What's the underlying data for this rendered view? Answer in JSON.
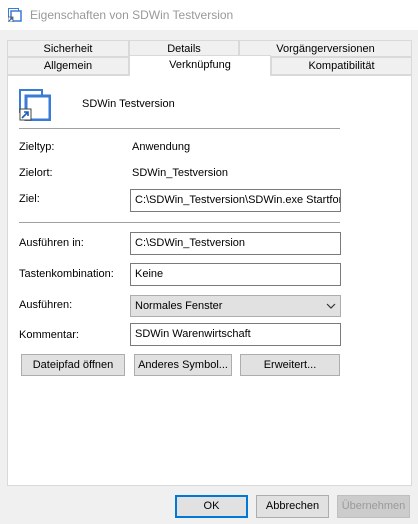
{
  "window": {
    "title": "Eigenschaften von SDWin Testversion"
  },
  "tabs": {
    "row1": [
      "Sicherheit",
      "Details",
      "Vorgängerversionen"
    ],
    "row2": [
      "Allgemein",
      "Verknüpfung",
      "Kompatibilität"
    ],
    "active": "Verknüpfung"
  },
  "header": {
    "name": "SDWin Testversion",
    "icon": "shortcut-icon"
  },
  "fields": {
    "zieltyp": {
      "label": "Zieltyp:",
      "value": "Anwendung"
    },
    "zielort": {
      "label": "Zielort:",
      "value": "SDWin_Testversion"
    },
    "ziel": {
      "label": "Ziel:",
      "value": "C:\\SDWin_Testversion\\SDWin.exe Startform"
    },
    "ausfuehren_in": {
      "label": "Ausführen in:",
      "value": "C:\\SDWin_Testversion"
    },
    "tastenkombination": {
      "label": "Tastenkombination:",
      "value": "Keine"
    },
    "ausfuehren": {
      "label": "Ausführen:",
      "value": "Normales Fenster"
    },
    "kommentar": {
      "label": "Kommentar:",
      "value": "SDWin Warenwirtschaft"
    }
  },
  "buttons": {
    "open_path": "Dateipfad öffnen",
    "change_icon": "Anderes Symbol...",
    "advanced": "Erweitert..."
  },
  "dialog": {
    "ok": "OK",
    "cancel": "Abbrechen",
    "apply": "Übernehmen"
  },
  "colors": {
    "accent": "#0078d7",
    "border": "#adadad",
    "panel": "#ffffff",
    "window": "#f0f0f0"
  }
}
